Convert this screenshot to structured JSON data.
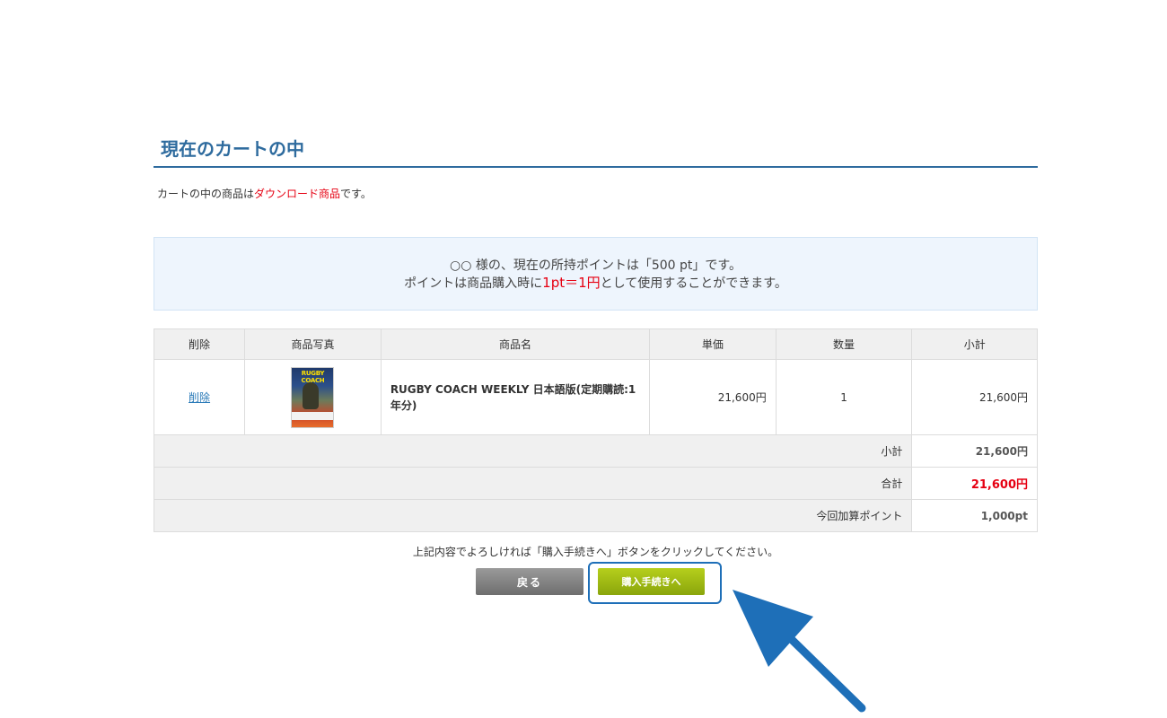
{
  "page": {
    "title": "現在のカートの中",
    "note_prefix": "カートの中の商品は",
    "note_highlight": "ダウンロード商品",
    "note_suffix": "です。"
  },
  "points": {
    "line1": "○○ 様の、現在の所持ポイントは「500 pt」です。",
    "line2_prefix": "ポイントは商品購入時に",
    "line2_highlight": "1pt＝1円",
    "line2_suffix": "として使用することができます。"
  },
  "table": {
    "headers": [
      "削除",
      "商品写真",
      "商品名",
      "単価",
      "数量",
      "小計"
    ],
    "item": {
      "delete_label": "削除",
      "thumb_text": "RUGBY COACH",
      "name": "RUGBY COACH WEEKLY 日本語版(定期購読:1年分)",
      "price": "21,600円",
      "quantity": "1",
      "subtotal": "21,600円"
    },
    "summary": [
      {
        "label": "小計",
        "value": "21,600円"
      },
      {
        "label": "合計",
        "value": "21,600円"
      },
      {
        "label": "今回加算ポイント",
        "value": "1,000pt"
      }
    ]
  },
  "instructions": "上記内容でよろしければ「購入手続きへ」ボタンをクリックしてください。",
  "buttons": {
    "back": "戻る",
    "next": "購入手続きへ"
  },
  "colors": {
    "accent": "#2e6b9e",
    "highlight_red": "#e60012",
    "annotation_blue": "#1e6fb8",
    "next_button_green": "#9fbb14"
  },
  "icons": {
    "annotation": "arrow-pointer-icon"
  }
}
